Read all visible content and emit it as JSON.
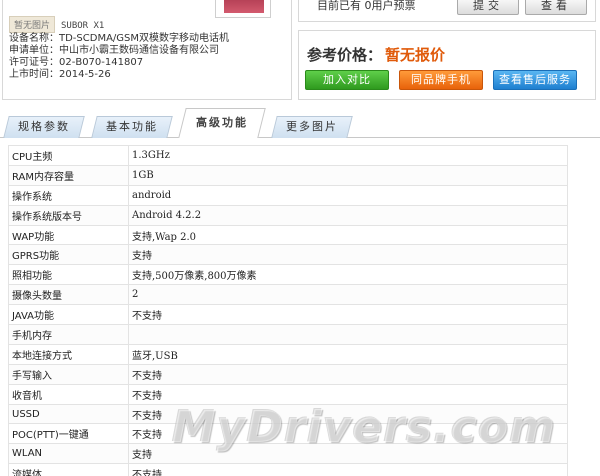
{
  "device": {
    "no_image_badge": "暂无图片",
    "model": "SUBOR X1",
    "name_line": "设备名称：TD-SCDMA/GSM双模数字移动电话机",
    "applicant_line": "申请单位：中山市小霸王数码通信设备有限公司",
    "license_line": "许可证号：02-B070-141807",
    "date_line": "上市时间：2014-5-26"
  },
  "top_right": {
    "user_count_text": "目前已有 0用户预票",
    "submit_label": "提交",
    "view_label": "查看"
  },
  "price": {
    "label": "参考价格：",
    "value": "暂无报价",
    "compare_label": "加入对比",
    "same_brand_label": "同品牌手机",
    "service_label": "查看售后服务"
  },
  "tabs": [
    {
      "label": "规格参数",
      "active": false
    },
    {
      "label": "基本功能",
      "active": false
    },
    {
      "label": "高级功能",
      "active": true
    },
    {
      "label": "更多图片",
      "active": false
    }
  ],
  "specs": [
    {
      "key": "CPU主频",
      "value": "1.3GHz"
    },
    {
      "key": "RAM内存容量",
      "value": "1GB"
    },
    {
      "key": "操作系统",
      "value": "android"
    },
    {
      "key": "操作系统版本号",
      "value": "Android 4.2.2"
    },
    {
      "key": "WAP功能",
      "value": "支持,Wap 2.0"
    },
    {
      "key": "GPRS功能",
      "value": "支持"
    },
    {
      "key": "照相功能",
      "value": "支持,500万像素,800万像素"
    },
    {
      "key": "摄像头数量",
      "value": "2"
    },
    {
      "key": "JAVA功能",
      "value": "不支持"
    },
    {
      "key": "手机内存",
      "value": ""
    },
    {
      "key": "本地连接方式",
      "value": "蓝牙,USB"
    },
    {
      "key": "手写输入",
      "value": "不支持"
    },
    {
      "key": "收音机",
      "value": "不支持"
    },
    {
      "key": "USSD",
      "value": "不支持"
    },
    {
      "key": "POC(PTT)一键通",
      "value": "不支持"
    },
    {
      "key": "WLAN",
      "value": "支持"
    },
    {
      "key": "流媒体",
      "value": "不支持"
    }
  ],
  "watermark": "MyDrivers.com"
}
